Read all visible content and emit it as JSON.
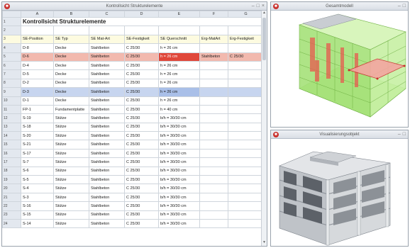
{
  "table_window": {
    "title": "Kontrollsicht Strukturelemente",
    "columns": [
      "A",
      "B",
      "C",
      "D",
      "E",
      "F",
      "G"
    ],
    "sheet_title": "Kontrollsicht Strukturelemente",
    "headers": [
      "SE-Position",
      "SE Typ",
      "SE Mat-Art",
      "SE-Festigkeit",
      "SE Querschnitt",
      "Erg-MatArt",
      "Erg-Festigkeit"
    ],
    "rows": [
      [
        "D-8",
        "Decke",
        "Stahlbeton",
        "C 25/30",
        "h = 26 cm",
        "",
        ""
      ],
      [
        "D-6",
        "Decke",
        "Stahlbeton",
        "C 25/30",
        "h = 26 cm",
        "Stahlbeton",
        "C 25/30"
      ],
      [
        "D-4",
        "Decke",
        "Stahlbeton",
        "C 25/30",
        "h = 26 cm",
        "",
        ""
      ],
      [
        "D-5",
        "Decke",
        "Stahlbeton",
        "C 25/30",
        "h = 26 cm",
        "",
        ""
      ],
      [
        "D-2",
        "Decke",
        "Stahlbeton",
        "C 25/30",
        "h = 26 cm",
        "",
        ""
      ],
      [
        "D-3",
        "Decke",
        "Stahlbeton",
        "C 25/30",
        "h = 26 cm",
        "",
        ""
      ],
      [
        "D-1",
        "Decke",
        "Stahlbeton",
        "C 25/30",
        "h = 26 cm",
        "",
        ""
      ],
      [
        "FP-1",
        "Fundamentplatte",
        "Stahlbeton",
        "C 25/30",
        "h = 40 cm",
        "",
        ""
      ],
      [
        "S-19",
        "Stütze",
        "Stahlbeton",
        "C 25/30",
        "b/h = 30/30 cm",
        "",
        ""
      ],
      [
        "S-18",
        "Stütze",
        "Stahlbeton",
        "C 25/30",
        "b/h = 30/30 cm",
        "",
        ""
      ],
      [
        "S-20",
        "Stütze",
        "Stahlbeton",
        "C 25/30",
        "b/h = 30/30 cm",
        "",
        ""
      ],
      [
        "S-21",
        "Stütze",
        "Stahlbeton",
        "C 25/30",
        "b/h = 30/30 cm",
        "",
        ""
      ],
      [
        "S-17",
        "Stütze",
        "Stahlbeton",
        "C 25/30",
        "b/h = 30/30 cm",
        "",
        ""
      ],
      [
        "S-7",
        "Stütze",
        "Stahlbeton",
        "C 25/30",
        "b/h = 30/30 cm",
        "",
        ""
      ],
      [
        "S-6",
        "Stütze",
        "Stahlbeton",
        "C 25/30",
        "b/h = 30/30 cm",
        "",
        ""
      ],
      [
        "S-5",
        "Stütze",
        "Stahlbeton",
        "C 25/30",
        "b/h = 30/30 cm",
        "",
        ""
      ],
      [
        "S-4",
        "Stütze",
        "Stahlbeton",
        "C 25/30",
        "b/h = 30/30 cm",
        "",
        ""
      ],
      [
        "S-3",
        "Stütze",
        "Stahlbeton",
        "C 25/30",
        "b/h = 30/30 cm",
        "",
        ""
      ],
      [
        "S-16",
        "Stütze",
        "Stahlbeton",
        "C 25/30",
        "b/h = 30/30 cm",
        "",
        ""
      ],
      [
        "S-15",
        "Stütze",
        "Stahlbeton",
        "C 25/30",
        "b/h = 30/30 cm",
        "",
        ""
      ],
      [
        "S-14",
        "Stütze",
        "Stahlbeton",
        "C 25/30",
        "b/h = 30/30 cm",
        "",
        ""
      ]
    ],
    "highlight_red_row": 1,
    "highlight_blue_row": 5
  },
  "model_window": {
    "title": "Gesamtmodell"
  },
  "viz_window": {
    "title": "Visualisierungsobjekt"
  },
  "window_controls": {
    "minimize": "–",
    "restore": "□",
    "close": "×"
  },
  "colors": {
    "accent_red": "#e0473a",
    "highlight_blue": "#c7d5ef",
    "model_green": "#9fe070"
  }
}
